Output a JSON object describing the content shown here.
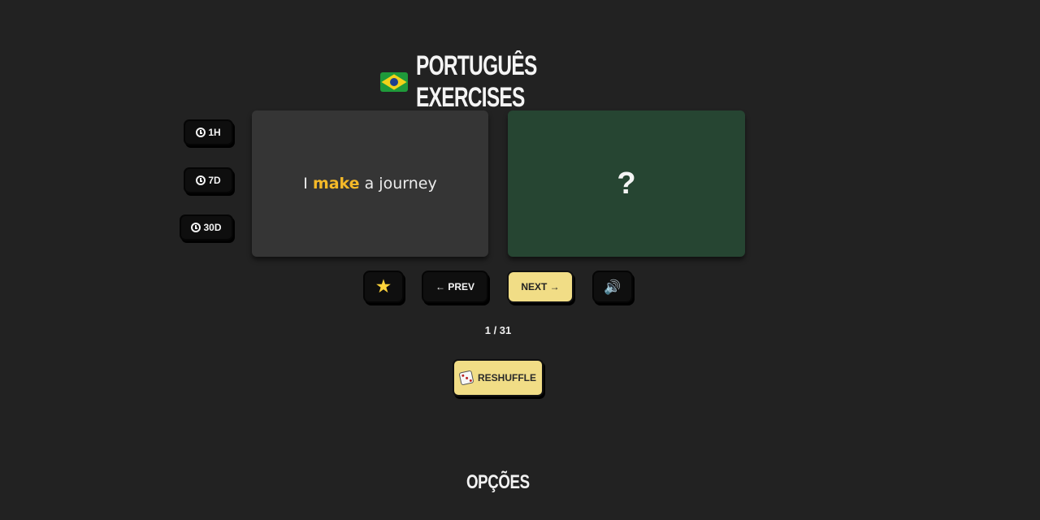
{
  "header": {
    "flag_icon": "brazil-flag-icon",
    "title": "PORTUGUÊS EXERCISES"
  },
  "time_filters": [
    {
      "label": "1H",
      "icon": "clock-icon"
    },
    {
      "label": "7D",
      "icon": "clock-icon"
    },
    {
      "label": "30D",
      "icon": "clock-icon"
    }
  ],
  "card": {
    "prompt_before": "I",
    "prompt_highlight": "make",
    "prompt_after": "a journey",
    "answer": "?",
    "highlight_color": "#f5b928",
    "front_color": "#353535",
    "back_color": "#264532"
  },
  "controls": {
    "favorite_icon": "star-icon",
    "prev_label": "← PREV",
    "next_label": "NEXT →",
    "audio_icon": "speaker-icon"
  },
  "counter": "1 / 31",
  "reshuffle": {
    "icon": "dice-icon",
    "label": "RESHUFFLE"
  },
  "options_heading": "OPÇÕES",
  "colors": {
    "background": "#222222",
    "accent_button": "#f1dd86",
    "dark_button": "#0f0f0f"
  }
}
